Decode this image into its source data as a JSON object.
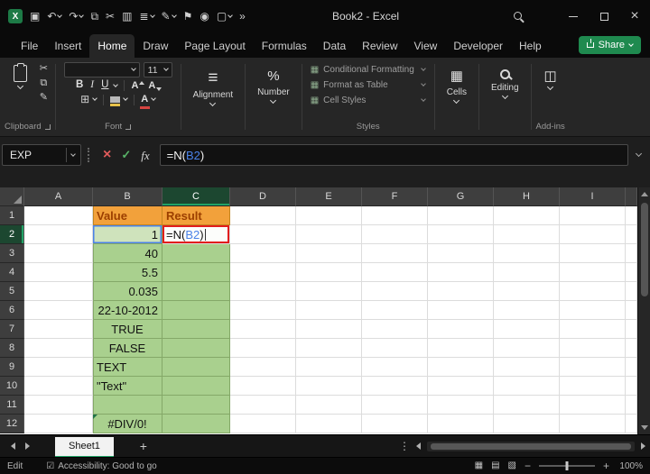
{
  "titlebar": {
    "title": "Book2 - Excel",
    "qat_icons": [
      "excel-logo-icon",
      "save-icon",
      "undo-icon",
      "redo-icon",
      "copy-icon",
      "cut-icon",
      "kanban-icon",
      "database-icon",
      "paintbrush-icon",
      "flag-icon",
      "camera-icon",
      "window-icon",
      "customize-toolbar-icon"
    ]
  },
  "menu": {
    "tabs": [
      "File",
      "Insert",
      "Home",
      "Draw",
      "Page Layout",
      "Formulas",
      "Data",
      "Review",
      "View",
      "Developer",
      "Help"
    ],
    "active": "Home",
    "share_label": "Share"
  },
  "ribbon": {
    "clipboard_label": "Clipboard",
    "font_label": "Font",
    "font_size": "11",
    "bold_label": "B",
    "italic_label": "I",
    "underline_label": "U",
    "alignment_label": "Alignment",
    "number_label": "Number",
    "styles_label": "Styles",
    "styles_items": [
      "Conditional Formatting",
      "Format as Table",
      "Cell Styles"
    ],
    "cells_label": "Cells",
    "editing_label": "Editing",
    "addins_label": "Add-ins"
  },
  "formula_bar": {
    "name_box_value": "EXP",
    "fx_label": "fx",
    "formula": {
      "prefix": "=N(",
      "ref": "B2",
      "suffix": ")"
    }
  },
  "sheet": {
    "col_headers": [
      "A",
      "B",
      "C",
      "D",
      "E",
      "F",
      "G",
      "H",
      "I",
      ""
    ],
    "selected_col": "C",
    "selected_row": "2",
    "rows": [
      {
        "n": "1",
        "b": "Value",
        "c": "Result",
        "kind": "header"
      },
      {
        "n": "2",
        "b": "1",
        "align": "right"
      },
      {
        "n": "3",
        "b": "40",
        "align": "right"
      },
      {
        "n": "4",
        "b": "5.5",
        "align": "right"
      },
      {
        "n": "5",
        "b": "0.035",
        "align": "right"
      },
      {
        "n": "6",
        "b": "22-10-2012",
        "align": "right"
      },
      {
        "n": "7",
        "b": "TRUE",
        "align": "center"
      },
      {
        "n": "8",
        "b": "FALSE",
        "align": "center"
      },
      {
        "n": "9",
        "b": "TEXT",
        "align": "left"
      },
      {
        "n": "10",
        "b": "\"Text\"",
        "align": "left"
      },
      {
        "n": "11",
        "b": "",
        "align": "left"
      },
      {
        "n": "12",
        "b": "#DIV/0!",
        "align": "center",
        "error": true
      }
    ]
  },
  "sheet_bar": {
    "tabs": [
      {
        "label": "Sheet1",
        "active": true
      }
    ]
  },
  "status_bar": {
    "mode": "Edit",
    "accessibility": "Accessibility: Good to go",
    "zoom_level": "100%"
  },
  "colors": {
    "accent_green": "#21a366",
    "share_green": "#1f8a4f",
    "ref_blue": "#4a82e8",
    "annotation_red": "#e11d1d",
    "header_fill_orange": "#f2a13b",
    "header_text_brown": "#9c3f00",
    "cell_fill_green": "#a9d08e",
    "active_cell_fill": "#cfe3bc"
  }
}
